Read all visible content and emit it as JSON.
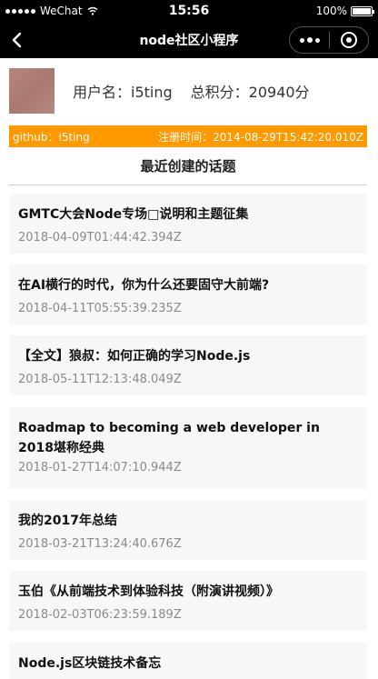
{
  "status_bar": {
    "carrier": "WeChat",
    "time": "15:56",
    "battery": "100%",
    "battery_level": 1.0
  },
  "nav_bar": {
    "title": "node社区小程序",
    "icons": [
      "back-arrow-icon",
      "more-dots-icon",
      "close-circle-icon"
    ]
  },
  "profile": {
    "username": "用户名：i5ting",
    "score": "总积分：20940分"
  },
  "info_bar": {
    "github": "github：i5ting",
    "registered": "注册时间：2014-08-29T15:42:20.010Z",
    "background_color": "#ff9900"
  },
  "section": {
    "title": "最近创建的话题"
  },
  "topics": [
    {
      "title": "GMTC大会Node专场□说明和主题征集",
      "date": "2018-04-09T01:44:42.394Z"
    },
    {
      "title": "在AI横行的时代，你为什么还要固守大前端?",
      "date": "2018-04-11T05:55:39.235Z"
    },
    {
      "title": "【全文】狼叔：如何正确的学习Node.js",
      "date": "2018-05-11T12:13:48.049Z"
    },
    {
      "title": "Roadmap to becoming a web developer in 2018堪称经典",
      "date": "2018-01-27T14:07:10.944Z"
    },
    {
      "title": "我的2017年总结",
      "date": "2018-03-21T13:24:40.676Z"
    },
    {
      "title": "玉伯《从前端技术到体验科技（附演讲视频）》",
      "date": "2018-02-03T06:23:59.189Z"
    },
    {
      "title": "Node.js区块链技术备忘",
      "date": ""
    }
  ]
}
